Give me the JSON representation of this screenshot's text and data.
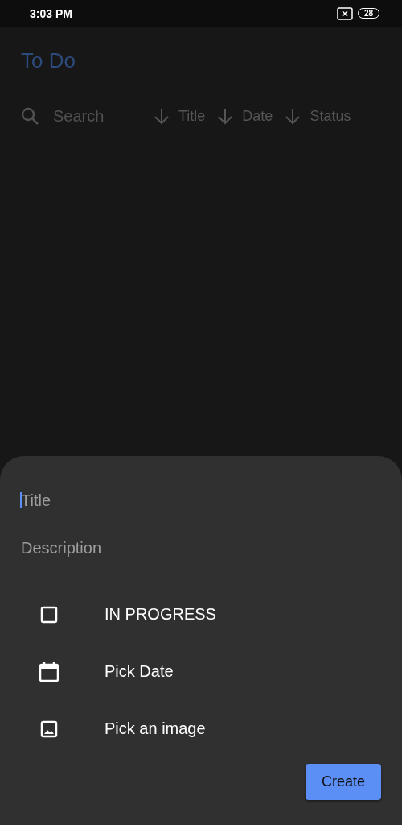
{
  "status_bar": {
    "time": "3:03 PM",
    "battery": "28"
  },
  "app_bar": {
    "title": "To Do"
  },
  "toolbar": {
    "search": {
      "placeholder": "Search"
    },
    "sort_options": [
      {
        "label": "Title"
      },
      {
        "label": "Date"
      },
      {
        "label": "Status"
      }
    ]
  },
  "sheet": {
    "fields": [
      {
        "placeholder": "Title",
        "focused": true
      },
      {
        "placeholder": "Description",
        "focused": false
      }
    ],
    "options": [
      {
        "kind": "checkbox",
        "label": "IN PROGRESS",
        "checked": false
      },
      {
        "kind": "date",
        "label": "Pick Date"
      },
      {
        "kind": "image",
        "label": "Pick an image"
      }
    ],
    "button": "Create"
  }
}
